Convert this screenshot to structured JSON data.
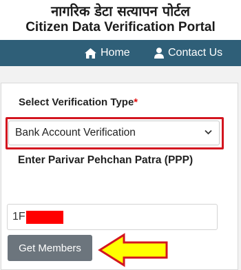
{
  "header": {
    "title_hindi": "नागरिक डेटा सत्यापन पोर्टल",
    "title_english": "Citizen Data Verification Portal"
  },
  "nav": {
    "home_label": "Home",
    "home_icon": "home-icon",
    "contact_label": "Contact Us",
    "contact_icon": "user-icon"
  },
  "form": {
    "verification_type_label": "Select Verification Type",
    "required_mark": "*",
    "verification_type_selected": "Bank Account Verification",
    "ppp_label": "Enter Parivar Pehchan Patra (PPP)",
    "ppp_value_prefix": "1F",
    "submit_label": "Get Members"
  },
  "colors": {
    "navbar": "#2f5f78",
    "highlight_border": "#d3151f",
    "button": "#6c757d",
    "arrow_fill": "#ffff00",
    "arrow_stroke": "#d3151f"
  }
}
